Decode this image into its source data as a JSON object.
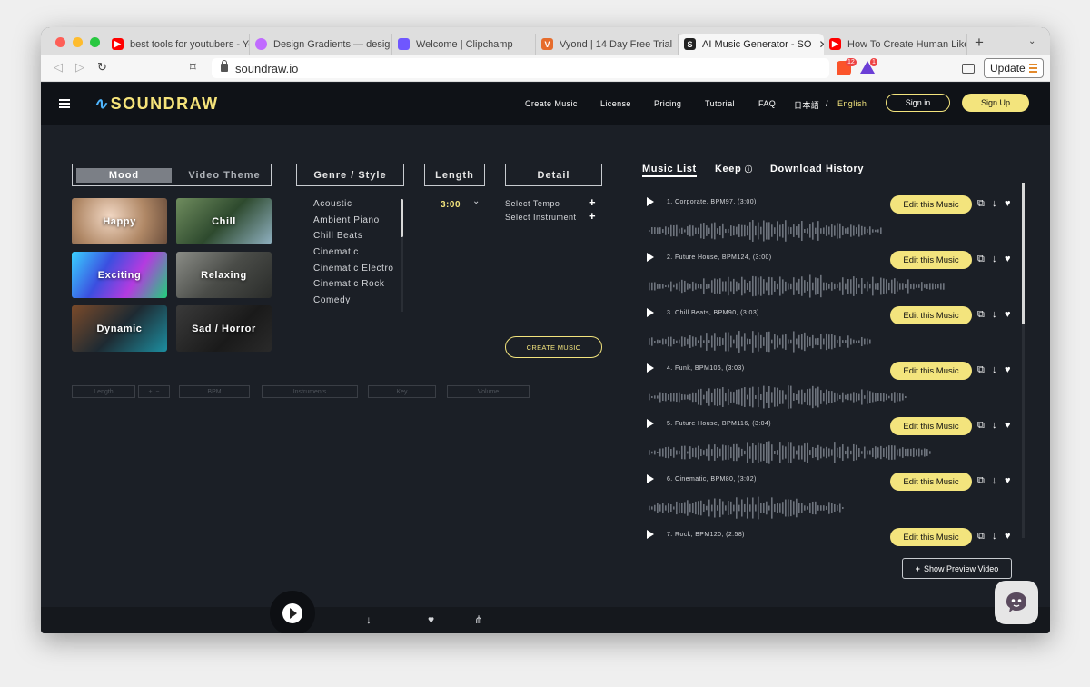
{
  "browser": {
    "tabs": [
      {
        "label": "best tools for youtubers - Yo",
        "fav": "#ff0000"
      },
      {
        "label": "Design Gradients — designgr",
        "fav": "#c06bff"
      },
      {
        "label": "Welcome | Clipchamp",
        "fav": "#6f57ff"
      },
      {
        "label": "Vyond | 14 Day Free Trial",
        "fav": "#e66c2c"
      },
      {
        "label": "AI Music Generator - SO",
        "fav": "#222222"
      },
      {
        "label": "How To Create Human Like V",
        "fav": "#ff0000"
      }
    ],
    "url": "soundraw.io",
    "update_label": "Update",
    "brave_badge": "12",
    "alert_badge": "1"
  },
  "site": {
    "logo": "SOUNDRAW",
    "nav": [
      "Create Music",
      "License",
      "Pricing",
      "Tutorial",
      "FAQ"
    ],
    "lang_ja": "日本語",
    "lang_sep": "/",
    "lang_en": "English",
    "signin": "Sign in",
    "signup": "Sign Up"
  },
  "filters": {
    "mood_tab": "Mood",
    "video_theme_tab": "Video Theme",
    "genre_header": "Genre / Style",
    "length_header": "Length",
    "detail_header": "Detail",
    "moods": [
      "Happy",
      "Chill",
      "Exciting",
      "Relaxing",
      "Dynamic",
      "Sad / Horror"
    ],
    "genres": [
      "Acoustic",
      "Ambient Piano",
      "Chill Beats",
      "Cinematic",
      "Cinematic Electro",
      "Cinematic Rock",
      "Comedy"
    ],
    "length_value": "3:00",
    "select_tempo": "Select Tempo",
    "select_instrument": "Select Instrument",
    "create_button": "CREATE MUSIC",
    "ghost_controls": [
      "Length",
      "BPM",
      "Instruments",
      "Key",
      "Volume"
    ]
  },
  "music": {
    "tabs": [
      "Music List",
      "Keep",
      "Download History"
    ],
    "edit_label": "Edit this Music",
    "tracks": [
      {
        "title": "1. Corporate, BPM97, (3:00)"
      },
      {
        "title": "2. Future House, BPM124, (3:00)"
      },
      {
        "title": "3. Chill Beats, BPM90, (3:03)"
      },
      {
        "title": "4. Funk, BPM106, (3:03)"
      },
      {
        "title": "5. Future House, BPM116, (3:04)"
      },
      {
        "title": "6. Cinematic, BPM80, (3:02)"
      },
      {
        "title": "7. Rock, BPM120, (2:58)"
      }
    ],
    "preview_button": "Show Preview Video"
  },
  "player": {
    "labels": [
      "Download",
      "Keep",
      "Share"
    ]
  },
  "colors": {
    "accent": "#f3e47d",
    "background": "#1b1f26",
    "header": "#0f1217"
  }
}
